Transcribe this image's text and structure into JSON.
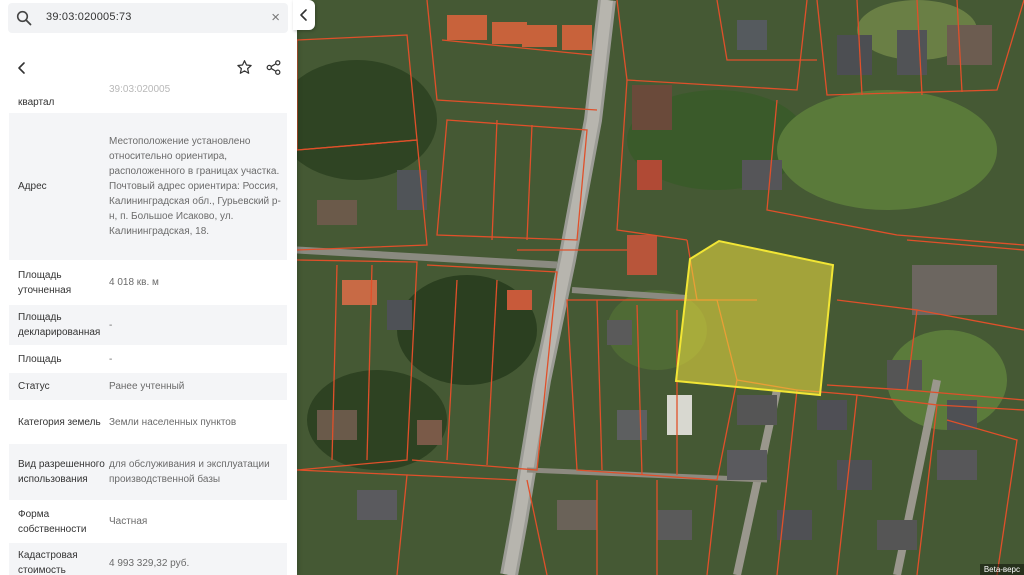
{
  "search": {
    "query": "39:03:020005:73",
    "clear_icon": "close-icon",
    "icon": "search-icon"
  },
  "toolbar": {
    "back_icon": "chevron-left-icon",
    "favorite_icon": "star-icon",
    "share_icon": "share-icon"
  },
  "collapse_icon": "chevron-left-icon",
  "details": [
    {
      "label": "квартал",
      "value": "39:03:020005"
    },
    {
      "label": "Адрес",
      "value": "Местоположение установлено относительно ориентира, расположенного в границах участка. Почтовый адрес ориентира: Россия, Калининградская обл., Гурьевский р-н, п. Большое Исаково, ул. Калининградская, 18."
    },
    {
      "label": "Площадь уточненная",
      "value": "4 018 кв. м"
    },
    {
      "label": "Площадь декларированная",
      "value": "-"
    },
    {
      "label": "Площадь",
      "value": "-"
    },
    {
      "label": "Статус",
      "value": "Ранее учтенный"
    },
    {
      "label": "Категория земель",
      "value": "Земли населенных пунктов"
    },
    {
      "label": "Вид разрешенного использования",
      "value": "для обслуживания и эксплуатации производственной базы"
    },
    {
      "label": "Форма собственности",
      "value": "Частная"
    },
    {
      "label": "Кадастровая стоимость",
      "value": "4 993 329,32 руб."
    }
  ],
  "map": {
    "attribution": "Beta-верс",
    "parcel_outline_color": "#e0502a",
    "selected_parcel_color": "#f0e040"
  }
}
